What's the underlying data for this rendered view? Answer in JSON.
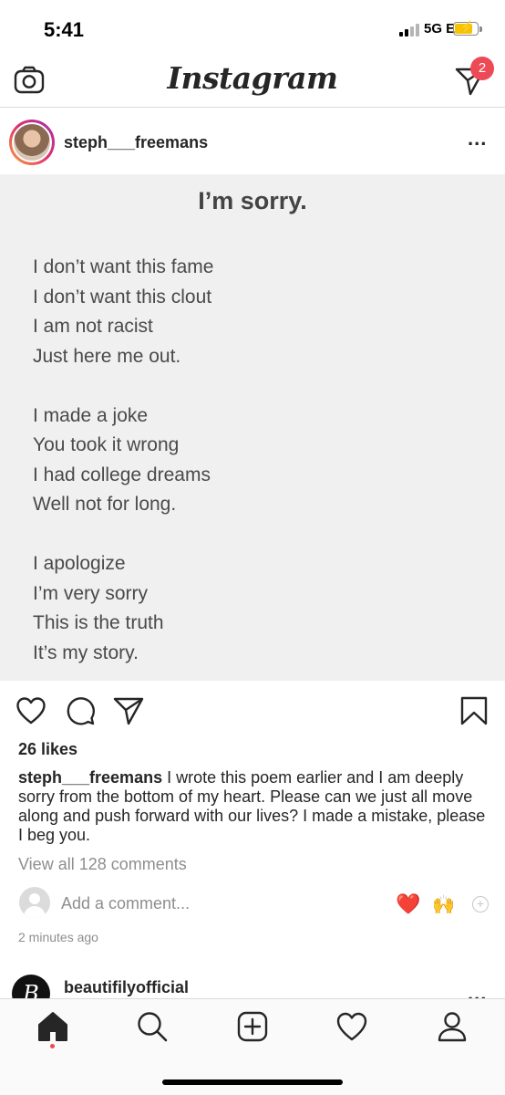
{
  "status_bar": {
    "time": "5:41",
    "network": "5G E",
    "battery_level": 0.7
  },
  "header": {
    "logo_text": "Instagram",
    "direct_badge_count": "2",
    "icons": {
      "camera": "camera-icon",
      "direct": "direct-message-icon"
    }
  },
  "post": {
    "username": "steph___freemans",
    "image": {
      "title": "I’m sorry.",
      "stanzas": [
        [
          "I don’t want this fame",
          "I don’t want this clout",
          "I am not racist",
          "Just here me out."
        ],
        [
          "I made a joke",
          "You took it wrong",
          "I had college dreams",
          "Well not for long."
        ],
        [
          "I apologize",
          "I’m very sorry",
          "This is the truth",
          "It’s my story."
        ]
      ]
    },
    "likes": "26 likes",
    "caption_user": "steph___freemans",
    "caption_text": "I wrote this poem earlier and I am deeply sorry from the bottom of my heart. Please can we just all move along and push forward with our lives? I made a mistake, please I beg you.",
    "view_comments": "View all 128 comments",
    "comment_placeholder": "Add a comment...",
    "quick_reactions": [
      "❤️",
      "🙌"
    ],
    "timestamp": "2 minutes ago"
  },
  "next_post": {
    "username": "beautifilyofficial",
    "avatar_letter": "B"
  },
  "tab_bar": {
    "items": [
      "home-icon",
      "search-icon",
      "new-post-icon",
      "activity-icon",
      "profile-icon"
    ],
    "active": "home"
  },
  "colors": {
    "badge": "#ed4956",
    "text": "#262626",
    "muted": "#8e8e8e",
    "border": "#dbdbdb",
    "poem_bg": "#f0f0f0"
  }
}
